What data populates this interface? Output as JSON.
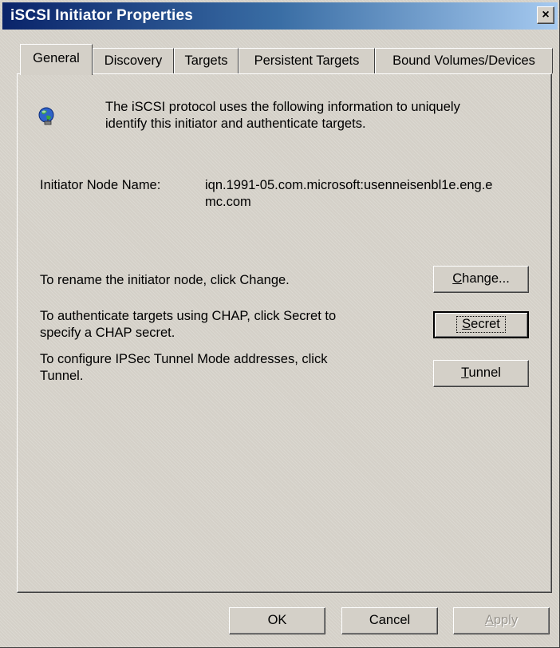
{
  "window": {
    "title": "iSCSI Initiator Properties",
    "close_glyph": "×"
  },
  "tabs": [
    {
      "label": "General",
      "active": true
    },
    {
      "label": "Discovery",
      "active": false
    },
    {
      "label": "Targets",
      "active": false
    },
    {
      "label": "Persistent Targets",
      "active": false
    },
    {
      "label": "Bound Volumes/Devices",
      "active": false
    }
  ],
  "general": {
    "intro_icon": "network-globe-icon",
    "intro_line1": "The iSCSI protocol uses the following information to uniquely",
    "intro_line2": "identify this initiator and authenticate targets.",
    "node_name_label": "Initiator Node Name:",
    "node_name_line1": "iqn.1991-05.com.microsoft:usenneisenbl1e.eng.e",
    "node_name_line2": "mc.com",
    "rename_text": "To rename the initiator node, click Change.",
    "chap_line1": "To authenticate targets using CHAP, click Secret to",
    "chap_line2": "specify a CHAP secret.",
    "tunnel_line1": "To configure IPSec Tunnel Mode addresses, click",
    "tunnel_line2": "Tunnel.",
    "change_button": {
      "mnemonic": "C",
      "rest": "hange..."
    },
    "secret_button": {
      "mnemonic": "S",
      "rest": "ecret"
    },
    "tunnel_button": {
      "mnemonic": "T",
      "rest": "unnel"
    }
  },
  "footer": {
    "ok": "OK",
    "cancel": "Cancel",
    "apply": {
      "mnemonic": "A",
      "rest": "pply",
      "enabled": false
    }
  }
}
